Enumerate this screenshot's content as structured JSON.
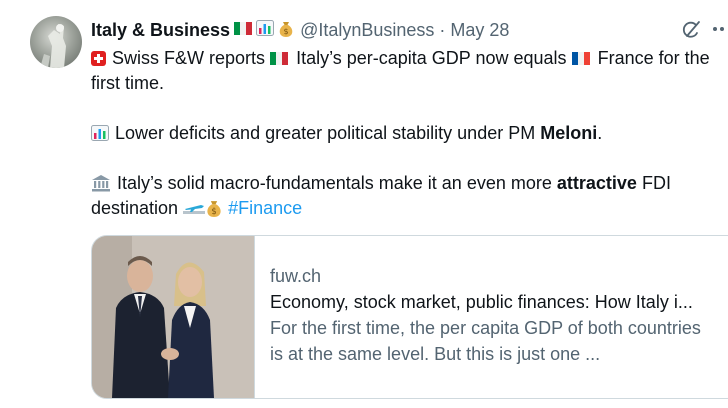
{
  "tweet": {
    "author_name": "Italy & Business",
    "handle": "@ItalynBusiness",
    "separator": "·",
    "date": "May 28",
    "name_emojis": [
      "italy-flag",
      "bar-chart",
      "money-bag"
    ],
    "line1_text": "Swiss F&W reports",
    "line1_mid": "Italy’s per-capita GDP now equals",
    "line1_end": "France for the first time.",
    "line2_text": "Lower deficits and greater political stability under PM",
    "line2_bold": "Meloni",
    "line2_end": ".",
    "line3_text": "Italy’s solid macro-fundamentals make it an even more",
    "line3_bold": "attractive",
    "line3_end": "FDI destination",
    "hashtag": "#Finance"
  },
  "card": {
    "domain": "fuw.ch",
    "title": "Economy, stock market, public finances: How Italy i...",
    "description": "For the first time, the per capita GDP of both countries is at the same level. But this is just one ..."
  },
  "colors": {
    "text": "#0f1419",
    "secondary": "#536471",
    "link": "#1d9bf0",
    "border": "#cfd9de"
  },
  "icons": [
    "avatar",
    "grok-icon",
    "more-icon",
    "swiss-flag",
    "italy-flag",
    "france-flag",
    "bar-chart-icon",
    "bank-icon",
    "airplane-icon",
    "money-bag-icon"
  ]
}
